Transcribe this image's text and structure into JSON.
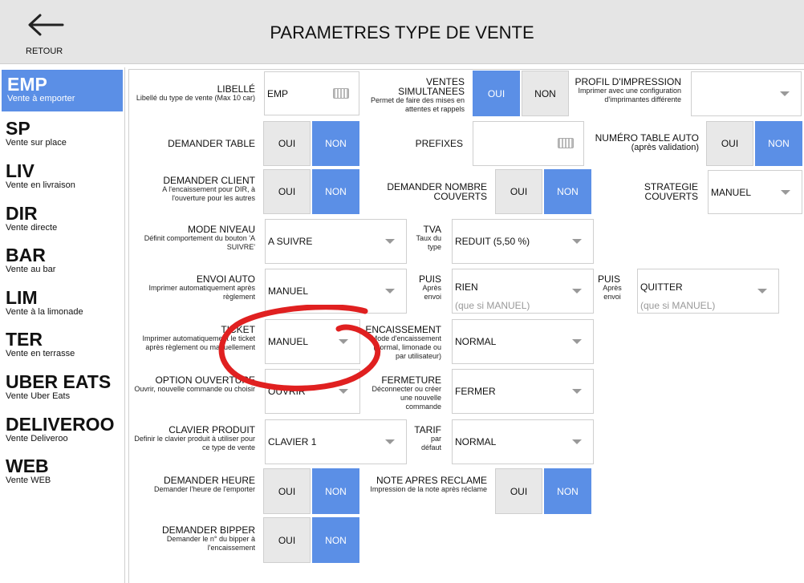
{
  "header": {
    "back_label": "RETOUR",
    "title": "PARAMETRES TYPE DE VENTE"
  },
  "sidebar": {
    "items": [
      {
        "code": "EMP",
        "desc": "Vente à emporter",
        "active": true
      },
      {
        "code": "SP",
        "desc": "Vente sur place"
      },
      {
        "code": "LIV",
        "desc": "Vente en livraison"
      },
      {
        "code": "DIR",
        "desc": "Vente directe"
      },
      {
        "code": "BAR",
        "desc": "Vente au bar"
      },
      {
        "code": "LIM",
        "desc": "Vente à la limonade"
      },
      {
        "code": "TER",
        "desc": "Vente en terrasse"
      },
      {
        "code": "UBER EATS",
        "desc": "Vente Uber Eats"
      },
      {
        "code": "DELIVEROO",
        "desc": "Vente Deliveroo"
      },
      {
        "code": "WEB",
        "desc": "Vente WEB"
      }
    ]
  },
  "form": {
    "libelle": {
      "title": "LIBELLÉ",
      "sub": "Libellé du type de vente (Max 10 car)",
      "value": "EMP"
    },
    "ventes_simultanees": {
      "title": "VENTES SIMULTANEES",
      "sub": "Permet de faire des mises en attentes et rappels",
      "yes": "OUI",
      "no": "NON",
      "selected": "OUI"
    },
    "profil_impression": {
      "title": "PROFIL D'IMPRESSION",
      "sub": "Imprimer avec une configuration d'imprimantes différente",
      "value": ""
    },
    "demander_table": {
      "title": "DEMANDER TABLE",
      "yes": "OUI",
      "no": "NON",
      "selected": "NON"
    },
    "prefixes": {
      "title": "PREFIXES",
      "value": ""
    },
    "numero_table_auto": {
      "title": "NUMÉRO TABLE AUTO",
      "sub": "(après validation)",
      "yes": "OUI",
      "no": "NON",
      "selected": "NON"
    },
    "demander_client": {
      "title": "DEMANDER CLIENT",
      "sub": "A l'encaissement pour DIR, à l'ouverture pour les autres",
      "yes": "OUI",
      "no": "NON",
      "selected": "NON"
    },
    "demander_nombre_couverts": {
      "title": "DEMANDER NOMBRE COUVERTS",
      "yes": "OUI",
      "no": "NON",
      "selected": "NON"
    },
    "strategie_couverts": {
      "title": "STRATEGIE COUVERTS",
      "value": "MANUEL"
    },
    "mode_niveau": {
      "title": "MODE NIVEAU",
      "sub": "Définit comportement du bouton 'A SUIVRE'",
      "value": "A SUIVRE"
    },
    "tva": {
      "title": "TVA",
      "sub": "Taux du type",
      "value": "REDUIT (5,50 %)"
    },
    "envoi_auto": {
      "title": "ENVOI AUTO",
      "sub": "Imprimer automatiquement après règlement",
      "value": "MANUEL"
    },
    "puis1": {
      "title": "PUIS",
      "sub": "Après envoi",
      "value": "RIEN",
      "hint": "(que si MANUEL)"
    },
    "puis2": {
      "title": "PUIS",
      "sub": "Après envoi",
      "value": "QUITTER",
      "hint": "(que si MANUEL)"
    },
    "ticket": {
      "title": "TICKET",
      "sub": "Imprimer automatiquement le ticket après règlement ou manuellement",
      "value": "MANUEL"
    },
    "encaissement": {
      "title": "ENCAISSEMENT",
      "sub": "Mode d'encaissement (normal, limonade ou par utilisateur)",
      "value": "NORMAL"
    },
    "option_ouverture": {
      "title": "OPTION OUVERTURE",
      "sub": "Ouvrir, nouvelle commande ou choisir",
      "value": "OUVRIR"
    },
    "fermeture": {
      "title": "FERMETURE",
      "sub": "Déconnecter ou créer une nouvelle commande",
      "value": "FERMER"
    },
    "clavier_produit": {
      "title": "CLAVIER PRODUIT",
      "sub": "Definir le clavier produit à utiliser pour ce type de vente",
      "value": "CLAVIER 1"
    },
    "tarif": {
      "title": "TARIF",
      "sub": "par défaut",
      "value": "NORMAL"
    },
    "demander_heure": {
      "title": "DEMANDER HEURE",
      "sub": "Demander l'heure de l'emporter",
      "yes": "OUI",
      "no": "NON",
      "selected": "NON"
    },
    "note_apres_reclame": {
      "title": "NOTE APRES RECLAME",
      "sub": "Impression de la note après réclame",
      "yes": "OUI",
      "no": "NON",
      "selected": "NON"
    },
    "demander_bipper": {
      "title": "DEMANDER BIPPER",
      "sub": "Demander le n° du bipper à l'encaissement",
      "yes": "OUI",
      "no": "NON",
      "selected": "NON"
    }
  },
  "colors": {
    "accent": "#5b8fe6",
    "annotation": "#e02020",
    "header_bg": "#e5e5e5"
  },
  "icons": {
    "back": "arrow-left-icon",
    "dropdown": "chevron-down-icon",
    "keyboard": "keyboard-icon"
  }
}
